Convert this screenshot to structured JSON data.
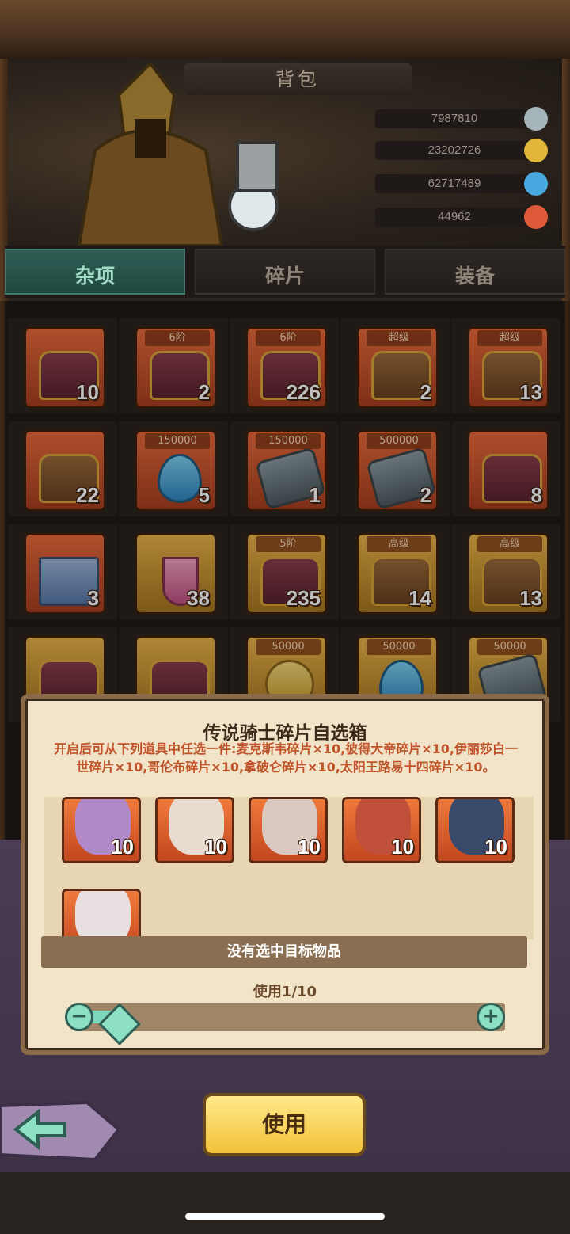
{
  "header": {
    "title": "背包"
  },
  "currencies": [
    {
      "value": "7987810",
      "icon": "stone-icon",
      "color": "#a5b4b8"
    },
    {
      "value": "23202726",
      "icon": "gold-coin-icon",
      "color": "#e2b63a"
    },
    {
      "value": "62717489",
      "icon": "water-drop-icon",
      "color": "#4aa8e0"
    },
    {
      "value": "44962",
      "icon": "red-gem-icon",
      "color": "#e05a3a"
    }
  ],
  "tabs": [
    {
      "label": "杂项",
      "active": true
    },
    {
      "label": "碎片",
      "active": false
    },
    {
      "label": "装备",
      "active": false
    }
  ],
  "items": [
    {
      "tag": "",
      "count": "10",
      "bg": "orange",
      "shape": "chest"
    },
    {
      "tag": "6阶",
      "count": "2",
      "bg": "orange",
      "shape": "chest"
    },
    {
      "tag": "6阶",
      "count": "226",
      "bg": "orange",
      "shape": "chest"
    },
    {
      "tag": "超级",
      "count": "2",
      "bg": "orange",
      "shape": "chest-brown"
    },
    {
      "tag": "超级",
      "count": "13",
      "bg": "orange",
      "shape": "chest-brown"
    },
    {
      "tag": "",
      "count": "22",
      "bg": "orange",
      "shape": "chest-brown"
    },
    {
      "tag": "150000",
      "count": "5",
      "bg": "orange",
      "shape": "drop"
    },
    {
      "tag": "150000",
      "count": "1",
      "bg": "orange",
      "shape": "stone"
    },
    {
      "tag": "500000",
      "count": "2",
      "bg": "orange",
      "shape": "stone"
    },
    {
      "tag": "",
      "count": "8",
      "bg": "orange",
      "shape": "chest"
    },
    {
      "tag": "",
      "count": "3",
      "bg": "orange",
      "shape": "gift"
    },
    {
      "tag": "",
      "count": "38",
      "bg": "gold",
      "shape": "glass"
    },
    {
      "tag": "5阶",
      "count": "235",
      "bg": "gold",
      "shape": "chest"
    },
    {
      "tag": "高级",
      "count": "14",
      "bg": "gold",
      "shape": "chest-brown"
    },
    {
      "tag": "高级",
      "count": "13",
      "bg": "gold",
      "shape": "chest-brown"
    },
    {
      "tag": "",
      "count": "",
      "bg": "gold",
      "shape": "chest"
    },
    {
      "tag": "",
      "count": "",
      "bg": "gold",
      "shape": "chest"
    },
    {
      "tag": "50000",
      "count": "",
      "bg": "gold",
      "shape": "coin"
    },
    {
      "tag": "50000",
      "count": "",
      "bg": "gold",
      "shape": "drop"
    },
    {
      "tag": "50000",
      "count": "",
      "bg": "gold",
      "shape": "stone"
    }
  ],
  "dialog": {
    "title": "传说骑士碎片自选箱",
    "description": "开启后可从下列道具中任选一件:麦克斯韦碎片×10,彼得大帝碎片×10,伊丽莎白一世碎片×10,哥伦布碎片×10,拿破仑碎片×10,太阳王路易十四碎片×10。",
    "heroes": [
      {
        "count": "10",
        "face": "#b08ac8"
      },
      {
        "count": "10",
        "face": "#e8dcd0"
      },
      {
        "count": "10",
        "face": "#d8c8c0"
      },
      {
        "count": "10",
        "face": "#c0503a"
      },
      {
        "count": "10",
        "face": "#3a4a6a"
      },
      {
        "count": "",
        "face": "#e8e0e0"
      }
    ],
    "status": "没有选中目标物品",
    "use_count": "使用1/10",
    "slider_level": 0.1,
    "minus": "−",
    "plus": "+"
  },
  "footer": {
    "use_button": "使用",
    "back_icon": "back-arrow-icon"
  }
}
